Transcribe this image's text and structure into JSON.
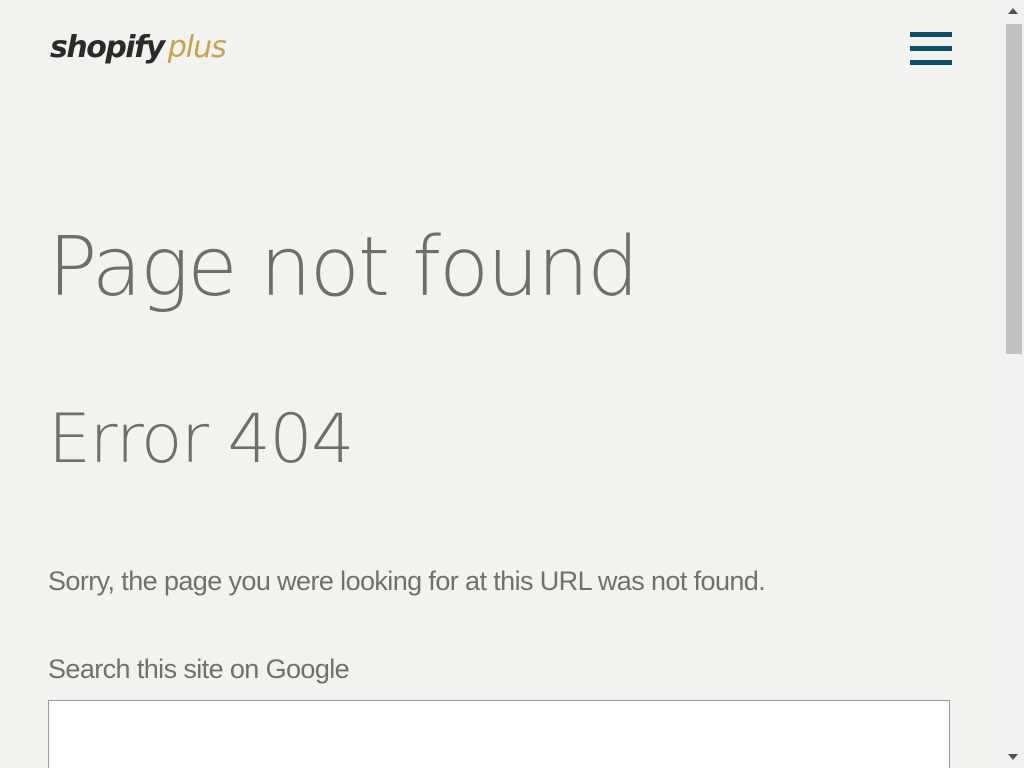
{
  "header": {
    "logo_main": "shopify",
    "logo_accent": "plus",
    "menu_icon": "hamburger-menu-icon"
  },
  "colors": {
    "background": "#f2f2f0",
    "logo_accent": "#c4a451",
    "menu_icon": "#0e4f69",
    "heading_text": "#6e6e6e",
    "body_text": "#707070"
  },
  "main": {
    "title": "Page not found",
    "subtitle": "Error 404",
    "message": "Sorry, the page you were looking for at this URL was not found.",
    "search_label": "Search this site on Google",
    "search_value": "",
    "search_placeholder": ""
  }
}
